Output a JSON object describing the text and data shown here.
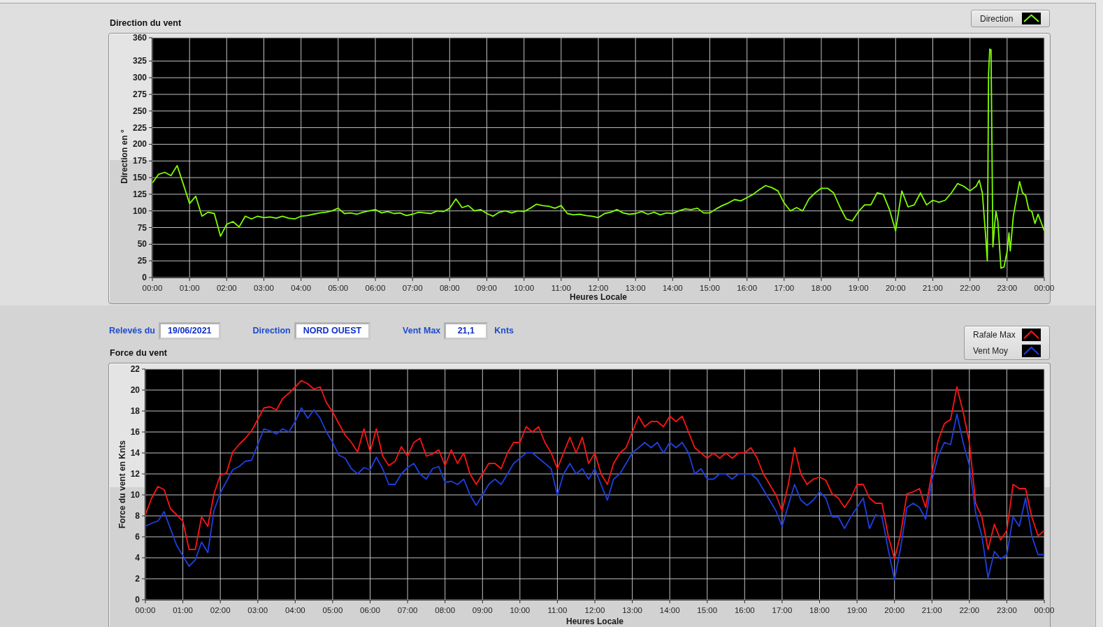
{
  "direction_panel": {
    "title": "Direction du vent",
    "chart_data": {
      "type": "line",
      "grid": true,
      "xlabel": "Heures Locale",
      "ylabel": "Direction en °",
      "x": [
        "2021-06-19T00:00",
        "2021-06-19T00:10",
        "2021-06-19T00:20",
        "2021-06-19T00:30",
        "2021-06-19T00:40",
        "2021-06-19T00:50",
        "2021-06-19T01:00",
        "2021-06-19T01:10",
        "2021-06-19T01:20",
        "2021-06-19T01:30",
        "2021-06-19T01:40",
        "2021-06-19T01:50",
        "2021-06-19T02:00",
        "2021-06-19T02:10",
        "2021-06-19T02:20",
        "2021-06-19T02:30",
        "2021-06-19T02:40",
        "2021-06-19T02:50",
        "2021-06-19T03:00",
        "2021-06-19T03:10",
        "2021-06-19T03:20",
        "2021-06-19T03:30",
        "2021-06-19T03:40",
        "2021-06-19T03:50",
        "2021-06-19T04:00",
        "2021-06-19T04:10",
        "2021-06-19T04:20",
        "2021-06-19T04:30",
        "2021-06-19T04:40",
        "2021-06-19T04:50",
        "2021-06-19T05:00",
        "2021-06-19T05:10",
        "2021-06-19T05:20",
        "2021-06-19T05:30",
        "2021-06-19T05:40",
        "2021-06-19T05:50",
        "2021-06-19T06:00",
        "2021-06-19T06:10",
        "2021-06-19T06:20",
        "2021-06-19T06:30",
        "2021-06-19T06:40",
        "2021-06-19T06:50",
        "2021-06-19T07:00",
        "2021-06-19T07:10",
        "2021-06-19T07:20",
        "2021-06-19T07:30",
        "2021-06-19T07:40",
        "2021-06-19T07:50",
        "2021-06-19T08:00",
        "2021-06-19T08:10",
        "2021-06-19T08:20",
        "2021-06-19T08:30",
        "2021-06-19T08:40",
        "2021-06-19T08:50",
        "2021-06-19T09:00",
        "2021-06-19T09:10",
        "2021-06-19T09:20",
        "2021-06-19T09:30",
        "2021-06-19T09:40",
        "2021-06-19T09:50",
        "2021-06-19T10:00",
        "2021-06-19T10:10",
        "2021-06-19T10:20",
        "2021-06-19T10:30",
        "2021-06-19T10:40",
        "2021-06-19T10:50",
        "2021-06-19T11:00",
        "2021-06-19T11:10",
        "2021-06-19T11:20",
        "2021-06-19T11:30",
        "2021-06-19T11:40",
        "2021-06-19T11:50",
        "2021-06-19T12:00",
        "2021-06-19T12:10",
        "2021-06-19T12:20",
        "2021-06-19T12:30",
        "2021-06-19T12:40",
        "2021-06-19T12:50",
        "2021-06-19T13:00",
        "2021-06-19T13:10",
        "2021-06-19T13:20",
        "2021-06-19T13:30",
        "2021-06-19T13:40",
        "2021-06-19T13:50",
        "2021-06-19T14:00",
        "2021-06-19T14:10",
        "2021-06-19T14:20",
        "2021-06-19T14:30",
        "2021-06-19T14:40",
        "2021-06-19T14:50",
        "2021-06-19T15:00",
        "2021-06-19T15:10",
        "2021-06-19T15:20",
        "2021-06-19T15:30",
        "2021-06-19T15:40",
        "2021-06-19T15:50",
        "2021-06-19T16:00",
        "2021-06-19T16:10",
        "2021-06-19T16:20",
        "2021-06-19T16:30",
        "2021-06-19T16:40",
        "2021-06-19T16:50",
        "2021-06-19T17:00",
        "2021-06-19T17:10",
        "2021-06-19T17:20",
        "2021-06-19T17:30",
        "2021-06-19T17:40",
        "2021-06-19T17:50",
        "2021-06-19T18:00",
        "2021-06-19T18:10",
        "2021-06-19T18:20",
        "2021-06-19T18:30",
        "2021-06-19T18:40",
        "2021-06-19T18:50",
        "2021-06-19T19:00",
        "2021-06-19T19:10",
        "2021-06-19T19:20",
        "2021-06-19T19:30",
        "2021-06-19T19:40",
        "2021-06-19T19:50",
        "2021-06-19T20:00",
        "2021-06-19T20:10",
        "2021-06-19T20:20",
        "2021-06-19T20:30",
        "2021-06-19T20:40",
        "2021-06-19T20:50",
        "2021-06-19T21:00",
        "2021-06-19T21:10",
        "2021-06-19T21:20",
        "2021-06-19T21:30",
        "2021-06-19T21:40",
        "2021-06-19T21:50",
        "2021-06-19T22:00",
        "2021-06-19T22:10",
        "2021-06-19T22:15",
        "2021-06-19T22:20",
        "2021-06-19T22:25",
        "2021-06-19T22:28",
        "2021-06-19T22:30",
        "2021-06-19T22:32",
        "2021-06-19T22:34",
        "2021-06-19T22:37",
        "2021-06-19T22:40",
        "2021-06-19T22:42",
        "2021-06-19T22:45",
        "2021-06-19T22:50",
        "2021-06-19T22:55",
        "2021-06-19T23:00",
        "2021-06-19T23:03",
        "2021-06-19T23:05",
        "2021-06-19T23:10",
        "2021-06-19T23:20",
        "2021-06-19T23:25",
        "2021-06-19T23:30",
        "2021-06-19T23:35",
        "2021-06-19T23:40",
        "2021-06-19T23:45",
        "2021-06-19T23:50",
        "2021-06-20T00:00"
      ],
      "series": [
        {
          "name": "Direction",
          "color": "#7fff00",
          "values": [
            142,
            155,
            158,
            153,
            168,
            140,
            111,
            122,
            92,
            98,
            96,
            62,
            80,
            84,
            76,
            92,
            88,
            92,
            90,
            91,
            89,
            92,
            89,
            88,
            92,
            93,
            95,
            97,
            98,
            100,
            104,
            96,
            97,
            95,
            98,
            100,
            102,
            97,
            99,
            96,
            97,
            93,
            95,
            98,
            97,
            96,
            100,
            99,
            104,
            118,
            105,
            108,
            100,
            102,
            96,
            92,
            98,
            100,
            97,
            100,
            99,
            104,
            110,
            108,
            107,
            104,
            108,
            96,
            94,
            95,
            93,
            92,
            90,
            96,
            98,
            102,
            97,
            95,
            96,
            99,
            95,
            98,
            94,
            97,
            96,
            100,
            103,
            102,
            104,
            97,
            97,
            103,
            108,
            112,
            117,
            115,
            120,
            125,
            132,
            138,
            135,
            130,
            112,
            100,
            105,
            100,
            118,
            127,
            134,
            134,
            127,
            106,
            88,
            85,
            99,
            109,
            109,
            127,
            125,
            102,
            70,
            130,
            106,
            109,
            127,
            109,
            116,
            113,
            116,
            127,
            141,
            137,
            130,
            137,
            146,
            127,
            67,
            25,
            306,
            343,
            342,
            46,
            81,
            99,
            85,
            14,
            16,
            39,
            67,
            40,
            92,
            144,
            127,
            123,
            102,
            99,
            81,
            95,
            70
          ]
        }
      ],
      "xlim": [
        "2021-06-19T00:00",
        "2021-06-20T00:00"
      ],
      "ylim": [
        0,
        360
      ],
      "xticks": [
        {
          "value": "2021-06-19T00:00",
          "label": "00:00"
        },
        {
          "value": "2021-06-19T01:00",
          "label": "01:00"
        },
        {
          "value": "2021-06-19T02:00",
          "label": "02:00"
        },
        {
          "value": "2021-06-19T03:00",
          "label": "03:00"
        },
        {
          "value": "2021-06-19T04:00",
          "label": "04:00"
        },
        {
          "value": "2021-06-19T05:00",
          "label": "05:00"
        },
        {
          "value": "2021-06-19T06:00",
          "label": "06:00"
        },
        {
          "value": "2021-06-19T07:00",
          "label": "07:00"
        },
        {
          "value": "2021-06-19T08:00",
          "label": "08:00"
        },
        {
          "value": "2021-06-19T09:00",
          "label": "09:00"
        },
        {
          "value": "2021-06-19T10:00",
          "label": "10:00"
        },
        {
          "value": "2021-06-19T11:00",
          "label": "11:00"
        },
        {
          "value": "2021-06-19T12:00",
          "label": "12:00"
        },
        {
          "value": "2021-06-19T13:00",
          "label": "13:00"
        },
        {
          "value": "2021-06-19T14:00",
          "label": "14:00"
        },
        {
          "value": "2021-06-19T15:00",
          "label": "15:00"
        },
        {
          "value": "2021-06-19T16:00",
          "label": "16:00"
        },
        {
          "value": "2021-06-19T17:00",
          "label": "17:00"
        },
        {
          "value": "2021-06-19T18:00",
          "label": "18:00"
        },
        {
          "value": "2021-06-19T19:00",
          "label": "19:00"
        },
        {
          "value": "2021-06-19T20:00",
          "label": "20:00"
        },
        {
          "value": "2021-06-19T21:00",
          "label": "21:00"
        },
        {
          "value": "2021-06-19T22:00",
          "label": "22:00"
        },
        {
          "value": "2021-06-19T23:00",
          "label": "23:00"
        },
        {
          "value": "2021-06-20T00:00",
          "label": "00:00"
        }
      ],
      "yticks": [
        0,
        25,
        50,
        75,
        100,
        125,
        150,
        175,
        200,
        225,
        250,
        275,
        300,
        325,
        360
      ]
    }
  },
  "readings": [
    {
      "label": "Relevés du",
      "value": "19/06/2021"
    },
    {
      "label": "Direction",
      "value": "NORD OUEST"
    },
    {
      "label": "Vent Max",
      "value": "21,1",
      "unit": "Knts"
    }
  ],
  "force_panel": {
    "title": "Force du vent",
    "chart_data": {
      "type": "line",
      "grid": true,
      "xlabel": "Heures Locale",
      "ylabel": "Force du vent en Knts",
      "x": [
        "2021-06-19T00:00",
        "2021-06-19T00:10",
        "2021-06-19T00:20",
        "2021-06-19T00:30",
        "2021-06-19T00:40",
        "2021-06-19T00:50",
        "2021-06-19T01:00",
        "2021-06-19T01:10",
        "2021-06-19T01:20",
        "2021-06-19T01:30",
        "2021-06-19T01:40",
        "2021-06-19T01:50",
        "2021-06-19T02:00",
        "2021-06-19T02:10",
        "2021-06-19T02:20",
        "2021-06-19T02:30",
        "2021-06-19T02:40",
        "2021-06-19T02:50",
        "2021-06-19T03:00",
        "2021-06-19T03:10",
        "2021-06-19T03:20",
        "2021-06-19T03:30",
        "2021-06-19T03:40",
        "2021-06-19T03:50",
        "2021-06-19T04:00",
        "2021-06-19T04:10",
        "2021-06-19T04:20",
        "2021-06-19T04:30",
        "2021-06-19T04:40",
        "2021-06-19T04:50",
        "2021-06-19T05:00",
        "2021-06-19T05:10",
        "2021-06-19T05:20",
        "2021-06-19T05:30",
        "2021-06-19T05:40",
        "2021-06-19T05:50",
        "2021-06-19T06:00",
        "2021-06-19T06:10",
        "2021-06-19T06:20",
        "2021-06-19T06:30",
        "2021-06-19T06:40",
        "2021-06-19T06:50",
        "2021-06-19T07:00",
        "2021-06-19T07:10",
        "2021-06-19T07:20",
        "2021-06-19T07:30",
        "2021-06-19T07:40",
        "2021-06-19T07:50",
        "2021-06-19T08:00",
        "2021-06-19T08:10",
        "2021-06-19T08:20",
        "2021-06-19T08:30",
        "2021-06-19T08:40",
        "2021-06-19T08:50",
        "2021-06-19T09:00",
        "2021-06-19T09:10",
        "2021-06-19T09:20",
        "2021-06-19T09:30",
        "2021-06-19T09:40",
        "2021-06-19T09:50",
        "2021-06-19T10:00",
        "2021-06-19T10:10",
        "2021-06-19T10:20",
        "2021-06-19T10:30",
        "2021-06-19T10:40",
        "2021-06-19T10:50",
        "2021-06-19T11:00",
        "2021-06-19T11:10",
        "2021-06-19T11:20",
        "2021-06-19T11:30",
        "2021-06-19T11:40",
        "2021-06-19T11:50",
        "2021-06-19T12:00",
        "2021-06-19T12:10",
        "2021-06-19T12:20",
        "2021-06-19T12:30",
        "2021-06-19T12:40",
        "2021-06-19T12:50",
        "2021-06-19T13:00",
        "2021-06-19T13:10",
        "2021-06-19T13:20",
        "2021-06-19T13:30",
        "2021-06-19T13:40",
        "2021-06-19T13:50",
        "2021-06-19T14:00",
        "2021-06-19T14:10",
        "2021-06-19T14:20",
        "2021-06-19T14:30",
        "2021-06-19T14:40",
        "2021-06-19T14:50",
        "2021-06-19T15:00",
        "2021-06-19T15:10",
        "2021-06-19T15:20",
        "2021-06-19T15:30",
        "2021-06-19T15:40",
        "2021-06-19T15:50",
        "2021-06-19T16:00",
        "2021-06-19T16:10",
        "2021-06-19T16:20",
        "2021-06-19T16:30",
        "2021-06-19T16:40",
        "2021-06-19T16:50",
        "2021-06-19T17:00",
        "2021-06-19T17:10",
        "2021-06-19T17:20",
        "2021-06-19T17:30",
        "2021-06-19T17:40",
        "2021-06-19T17:50",
        "2021-06-19T18:00",
        "2021-06-19T18:10",
        "2021-06-19T18:20",
        "2021-06-19T18:30",
        "2021-06-19T18:40",
        "2021-06-19T18:50",
        "2021-06-19T19:00",
        "2021-06-19T19:10",
        "2021-06-19T19:20",
        "2021-06-19T19:30",
        "2021-06-19T19:40",
        "2021-06-19T19:50",
        "2021-06-19T20:00",
        "2021-06-19T20:10",
        "2021-06-19T20:20",
        "2021-06-19T20:30",
        "2021-06-19T20:40",
        "2021-06-19T20:50",
        "2021-06-19T21:00",
        "2021-06-19T21:10",
        "2021-06-19T21:20",
        "2021-06-19T21:30",
        "2021-06-19T21:40",
        "2021-06-19T21:50",
        "2021-06-19T22:00",
        "2021-06-19T22:10",
        "2021-06-19T22:20",
        "2021-06-19T22:30",
        "2021-06-19T22:40",
        "2021-06-19T22:50",
        "2021-06-19T23:00",
        "2021-06-19T23:10",
        "2021-06-19T23:20",
        "2021-06-19T23:30",
        "2021-06-19T23:40",
        "2021-06-19T23:50",
        "2021-06-20T00:00"
      ],
      "series": [
        {
          "name": "Rafale Max",
          "color": "#ff1414",
          "values": [
            8.1,
            9.7,
            10.8,
            10.5,
            8.7,
            8.1,
            7.5,
            4.8,
            4.8,
            7.9,
            7.0,
            10.1,
            11.9,
            12.1,
            14.1,
            14.8,
            15.4,
            16.1,
            17.2,
            18.3,
            18.4,
            18.1,
            19.2,
            19.7,
            20.3,
            20.9,
            20.6,
            20.1,
            20.3,
            18.8,
            17.9,
            16.8,
            15.7,
            15.0,
            14.1,
            16.3,
            14.1,
            16.3,
            13.7,
            12.8,
            13.2,
            14.6,
            13.7,
            15.0,
            15.4,
            13.7,
            13.9,
            14.3,
            12.8,
            14.3,
            13.0,
            14.0,
            12.0,
            11.0,
            12.0,
            13.0,
            13.0,
            12.5,
            14.0,
            15.0,
            15.0,
            16.5,
            16.0,
            16.5,
            15.0,
            14.0,
            12.5,
            14.0,
            15.5,
            14.0,
            15.5,
            13.0,
            14.0,
            12.0,
            11.0,
            13.0,
            14.0,
            14.5,
            16.0,
            17.5,
            16.5,
            17.0,
            17.0,
            16.5,
            17.5,
            17.0,
            17.5,
            16.0,
            14.5,
            14.0,
            13.5,
            14.0,
            13.5,
            14.0,
            13.5,
            14.0,
            14.0,
            14.5,
            13.5,
            12.0,
            11.0,
            10.0,
            8.5,
            11.0,
            14.5,
            12.0,
            11.0,
            11.5,
            11.7,
            11.4,
            10.1,
            9.7,
            8.8,
            9.7,
            11.0,
            11.0,
            9.7,
            9.2,
            9.2,
            6.1,
            3.9,
            6.3,
            10.1,
            10.3,
            10.6,
            8.8,
            12.1,
            15.2,
            16.8,
            17.2,
            20.3,
            17.9,
            15.0,
            9.2,
            7.9,
            4.8,
            7.2,
            5.7,
            6.6,
            11.0,
            10.6,
            10.6,
            7.9,
            6.1,
            6.6
          ]
        },
        {
          "name": "Vent Moy",
          "color": "#1e3fe0",
          "values": [
            7.0,
            7.3,
            7.5,
            8.4,
            6.8,
            5.2,
            4.2,
            3.2,
            3.8,
            5.5,
            4.5,
            8.5,
            10.2,
            11.3,
            12.4,
            12.7,
            13.2,
            13.3,
            14.8,
            16.3,
            16.1,
            15.8,
            16.3,
            16.0,
            17.0,
            18.3,
            17.3,
            18.1,
            17.3,
            16.0,
            15.0,
            13.8,
            13.5,
            12.5,
            12.0,
            12.6,
            12.4,
            13.6,
            12.5,
            11.0,
            11.0,
            12.0,
            12.6,
            13.0,
            12.0,
            11.5,
            12.5,
            12.7,
            11.2,
            11.3,
            11.0,
            11.5,
            10.0,
            9.0,
            10.0,
            11.0,
            11.5,
            11.0,
            12.0,
            13.0,
            13.5,
            14.0,
            14.0,
            13.5,
            13.0,
            12.5,
            10.0,
            12.0,
            13.0,
            12.0,
            12.5,
            11.5,
            12.5,
            11.0,
            9.5,
            11.5,
            12.0,
            13.0,
            14.0,
            14.5,
            15.0,
            14.5,
            15.0,
            14.0,
            15.0,
            14.5,
            15.0,
            14.0,
            12.0,
            12.5,
            11.5,
            11.5,
            12.0,
            12.0,
            11.5,
            12.0,
            12.0,
            12.0,
            11.5,
            10.5,
            9.5,
            8.5,
            7.0,
            9.0,
            11.0,
            9.5,
            9.0,
            9.5,
            10.3,
            9.7,
            7.9,
            7.9,
            6.8,
            7.9,
            8.8,
            9.7,
            6.8,
            8.1,
            7.9,
            4.8,
            1.9,
            5.0,
            8.8,
            9.2,
            8.8,
            7.7,
            11.4,
            13.7,
            15.0,
            14.8,
            17.7,
            15.0,
            12.8,
            8.3,
            6.1,
            2.1,
            4.6,
            3.9,
            4.3,
            7.9,
            7.0,
            9.7,
            6.1,
            4.3,
            4.3
          ]
        }
      ],
      "xlim": [
        "2021-06-19T00:00",
        "2021-06-20T00:00"
      ],
      "ylim": [
        0,
        22
      ],
      "xticks": [
        {
          "value": "2021-06-19T00:00",
          "label": "00:00"
        },
        {
          "value": "2021-06-19T01:00",
          "label": "01:00"
        },
        {
          "value": "2021-06-19T02:00",
          "label": "02:00"
        },
        {
          "value": "2021-06-19T03:00",
          "label": "03:00"
        },
        {
          "value": "2021-06-19T04:00",
          "label": "04:00"
        },
        {
          "value": "2021-06-19T05:00",
          "label": "05:00"
        },
        {
          "value": "2021-06-19T06:00",
          "label": "06:00"
        },
        {
          "value": "2021-06-19T07:00",
          "label": "07:00"
        },
        {
          "value": "2021-06-19T08:00",
          "label": "08:00"
        },
        {
          "value": "2021-06-19T09:00",
          "label": "09:00"
        },
        {
          "value": "2021-06-19T10:00",
          "label": "10:00"
        },
        {
          "value": "2021-06-19T11:00",
          "label": "11:00"
        },
        {
          "value": "2021-06-19T12:00",
          "label": "12:00"
        },
        {
          "value": "2021-06-19T13:00",
          "label": "13:00"
        },
        {
          "value": "2021-06-19T14:00",
          "label": "14:00"
        },
        {
          "value": "2021-06-19T15:00",
          "label": "15:00"
        },
        {
          "value": "2021-06-19T16:00",
          "label": "16:00"
        },
        {
          "value": "2021-06-19T17:00",
          "label": "17:00"
        },
        {
          "value": "2021-06-19T18:00",
          "label": "18:00"
        },
        {
          "value": "2021-06-19T19:00",
          "label": "19:00"
        },
        {
          "value": "2021-06-19T20:00",
          "label": "20:00"
        },
        {
          "value": "2021-06-19T21:00",
          "label": "21:00"
        },
        {
          "value": "2021-06-19T22:00",
          "label": "22:00"
        },
        {
          "value": "2021-06-19T23:00",
          "label": "23:00"
        },
        {
          "value": "2021-06-20T00:00",
          "label": "00:00"
        }
      ],
      "yticks": [
        0,
        2,
        4,
        6,
        8,
        10,
        12,
        14,
        16,
        18,
        20,
        22
      ]
    }
  }
}
